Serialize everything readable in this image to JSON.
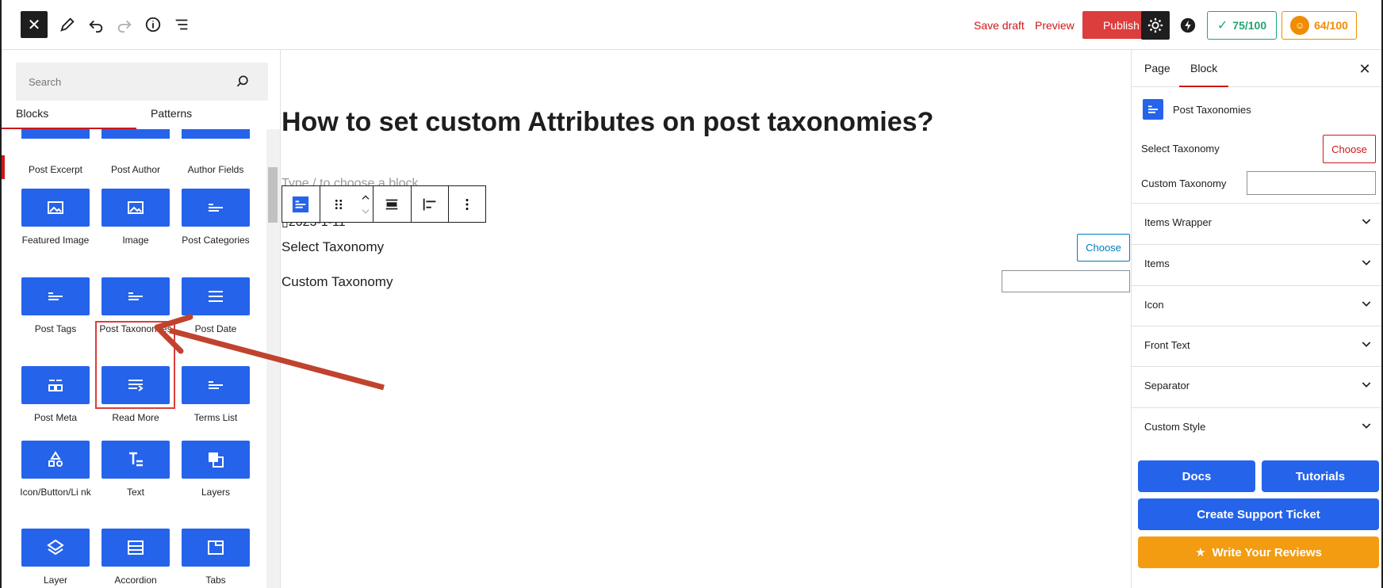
{
  "topbar": {
    "save_draft": "Save draft",
    "preview": "Preview",
    "publish": "Publish",
    "score_seo": "75/100",
    "score_readability": "64/100",
    "icons": [
      "close-icon",
      "pen-icon",
      "undo-icon",
      "redo-icon",
      "info-icon",
      "list-view-icon",
      "gear-icon",
      "bolt-icon"
    ]
  },
  "inserter": {
    "search_placeholder": "Search",
    "tabs": {
      "blocks": "Blocks",
      "patterns": "Patterns"
    },
    "top_row": [
      "Post Excerpt",
      "Post Author",
      "Author Fields"
    ],
    "blocks": [
      {
        "label": "Featured Image",
        "icon": "image-icon"
      },
      {
        "label": "Image",
        "icon": "image-icon"
      },
      {
        "label": "Post Categories",
        "icon": "list-icon"
      },
      {
        "label": "Post Tags",
        "icon": "list-icon"
      },
      {
        "label": "Post Taxonomies",
        "icon": "list-icon"
      },
      {
        "label": "Post Date",
        "icon": "lines-icon"
      },
      {
        "label": "Post Meta",
        "icon": "meta-icon"
      },
      {
        "label": "Read More",
        "icon": "read-more-icon"
      },
      {
        "label": "Terms List",
        "icon": "list-icon"
      },
      {
        "label": "Icon/Button/Li nk",
        "icon": "shapes-icon"
      },
      {
        "label": "Text",
        "icon": "text-icon"
      },
      {
        "label": "Layers",
        "icon": "layers-icon"
      },
      {
        "label": "Layer",
        "icon": "layer-icon"
      },
      {
        "label": "Accordion",
        "icon": "accordion-icon"
      },
      {
        "label": "Tabs",
        "icon": "tabs-icon"
      }
    ]
  },
  "editor": {
    "title": "How to set custom Attributes on post taxonomies?",
    "placeholder": "Type / to choose a block",
    "date": "2023-1-11",
    "select_taxonomy": "Select Taxonomy",
    "choose": "Choose",
    "custom_taxonomy": "Custom Taxonomy"
  },
  "sidebar": {
    "tabs": {
      "page": "Page",
      "block": "Block"
    },
    "block_title": "Post Taxonomies",
    "select_taxonomy": "Select Taxonomy",
    "choose": "Choose",
    "custom_taxonomy": "Custom Taxonomy",
    "panels": [
      "Items Wrapper",
      "Items",
      "Icon",
      "Front Text",
      "Separator",
      "Custom Style"
    ],
    "buttons": {
      "docs": "Docs",
      "tutorials": "Tutorials",
      "support": "Create Support Ticket",
      "reviews": "Write Your Reviews"
    },
    "colors": {
      "accent": "#2563eb",
      "danger": "#dc3d3d",
      "review": "#f39c12"
    }
  }
}
